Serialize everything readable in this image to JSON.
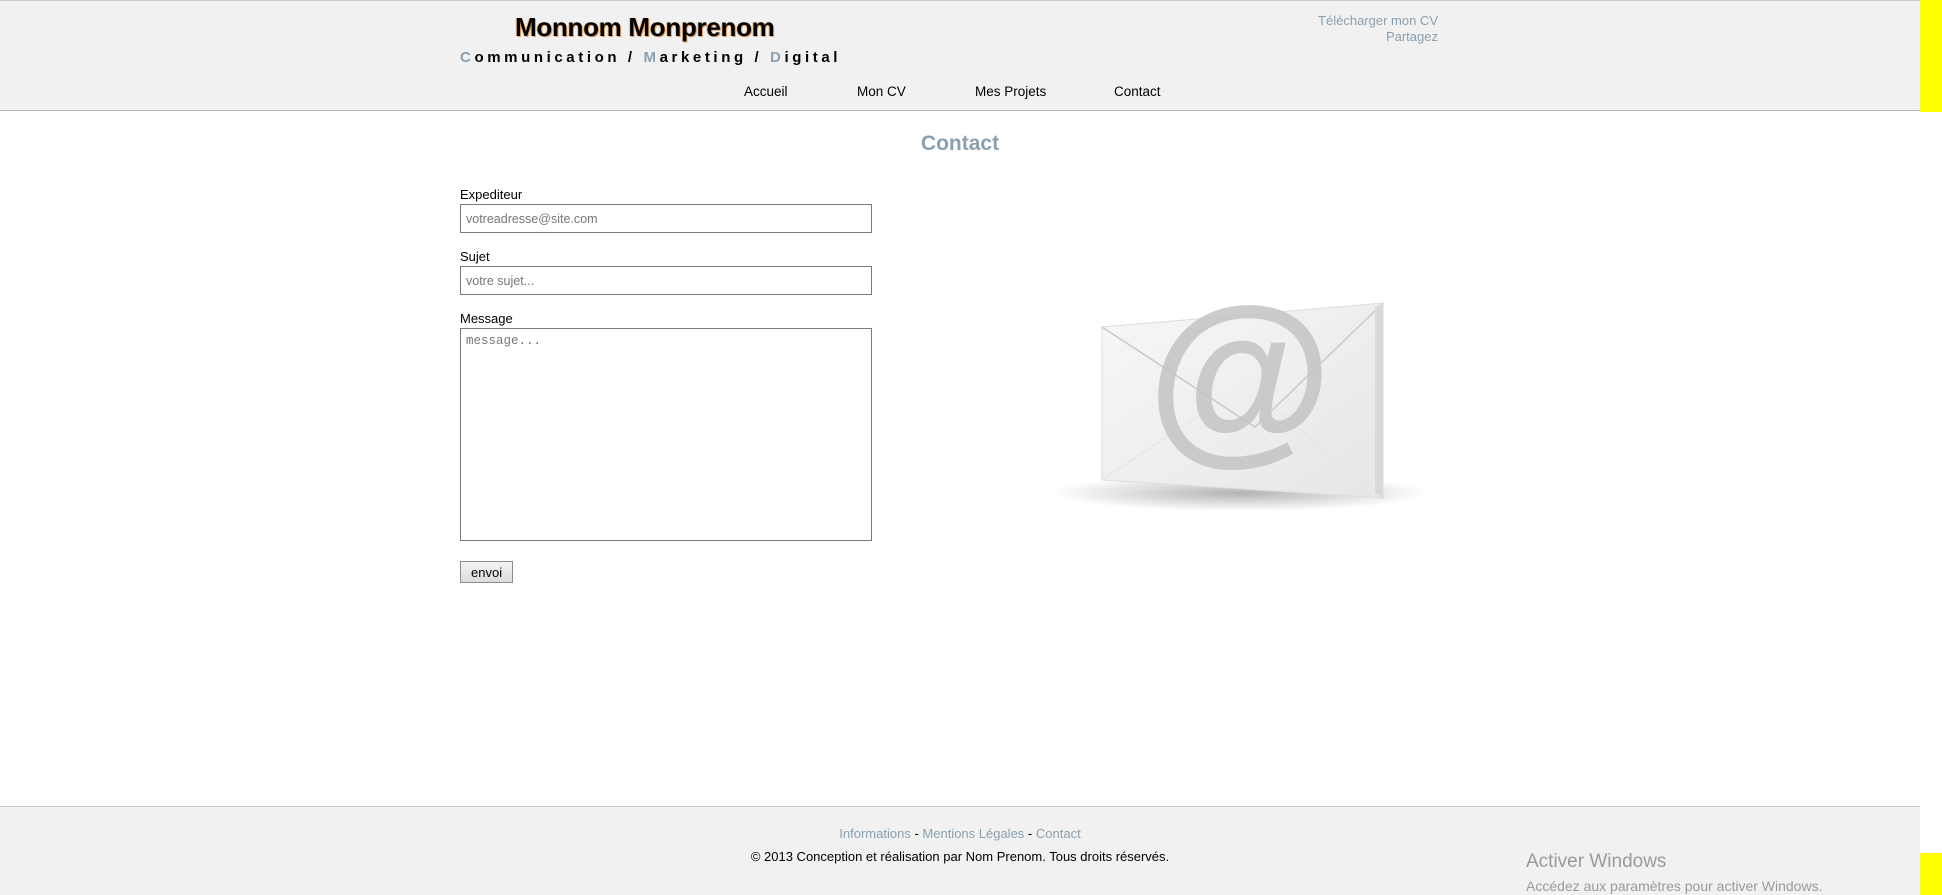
{
  "header": {
    "name": "Monnom Monprenom",
    "tagline": [
      {
        "initial": "C",
        "rest": "ommunication"
      },
      {
        "sep": " / "
      },
      {
        "initial": "M",
        "rest": "arketing"
      },
      {
        "sep": " / "
      },
      {
        "initial": "D",
        "rest": "igital"
      }
    ],
    "top_links": {
      "download_cv": "Télécharger mon CV",
      "share": "Partagez"
    },
    "nav": [
      "Accueil",
      "Mon CV",
      "Mes Projets",
      "Contact"
    ]
  },
  "main": {
    "title": "Contact",
    "form": {
      "sender_label": "Expediteur",
      "sender_placeholder": "votreadresse@site.com",
      "subject_label": "Sujet",
      "subject_placeholder": "votre sujet...",
      "message_label": "Message",
      "message_placeholder": "message...",
      "submit_label": "envoi"
    },
    "illustration_icon": "envelope-at-icon"
  },
  "footer": {
    "links": [
      "Informations",
      "Mentions Légales",
      "Contact"
    ],
    "separator": " - ",
    "copyright": "© 2013 Conception et réalisation par Nom Prenom. Tous droits réservés."
  },
  "os_watermark": {
    "title": "Activer Windows",
    "subtitle": "Accédez aux paramètres pour activer Windows."
  },
  "colors": {
    "accent": "#8aa0b0",
    "header_bg": "#f1f1f1",
    "scrollbar_highlight": "#ffff00"
  }
}
